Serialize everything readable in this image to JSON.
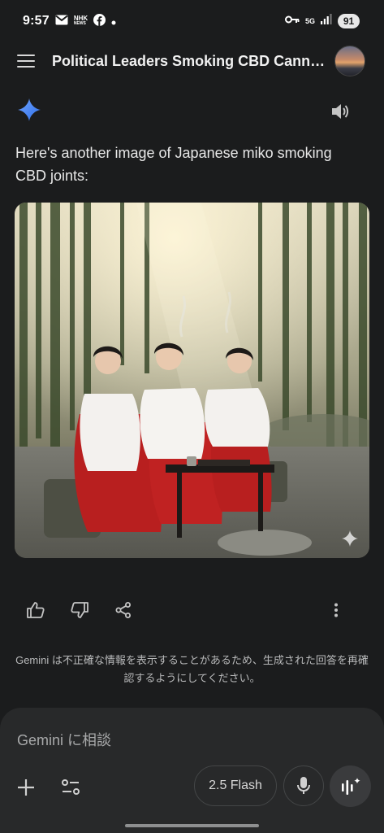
{
  "status_bar": {
    "time": "9:57",
    "notification_icons": [
      "gmail-icon",
      "nhk-news-icon",
      "facebook-icon",
      "dot-icon"
    ],
    "nhk_label": "NHK\nNEWS",
    "network_label": "5G",
    "battery": "91"
  },
  "app_bar": {
    "title": "Political Leaders Smoking CBD Canna..."
  },
  "response": {
    "text": "Here's another image of Japanese miko smoking CBD joints:"
  },
  "disclaimer": "Gemini は不正確な情報を表示することがあるため、生成された回答を再確認するようにしてください。",
  "input": {
    "placeholder": "Gemini に相談",
    "model_label": "2.5 Flash"
  },
  "colors": {
    "background": "#1b1c1d",
    "panel": "#28292a",
    "gemini_blue": "#4e8cf5",
    "text": "#e3e3e3"
  }
}
